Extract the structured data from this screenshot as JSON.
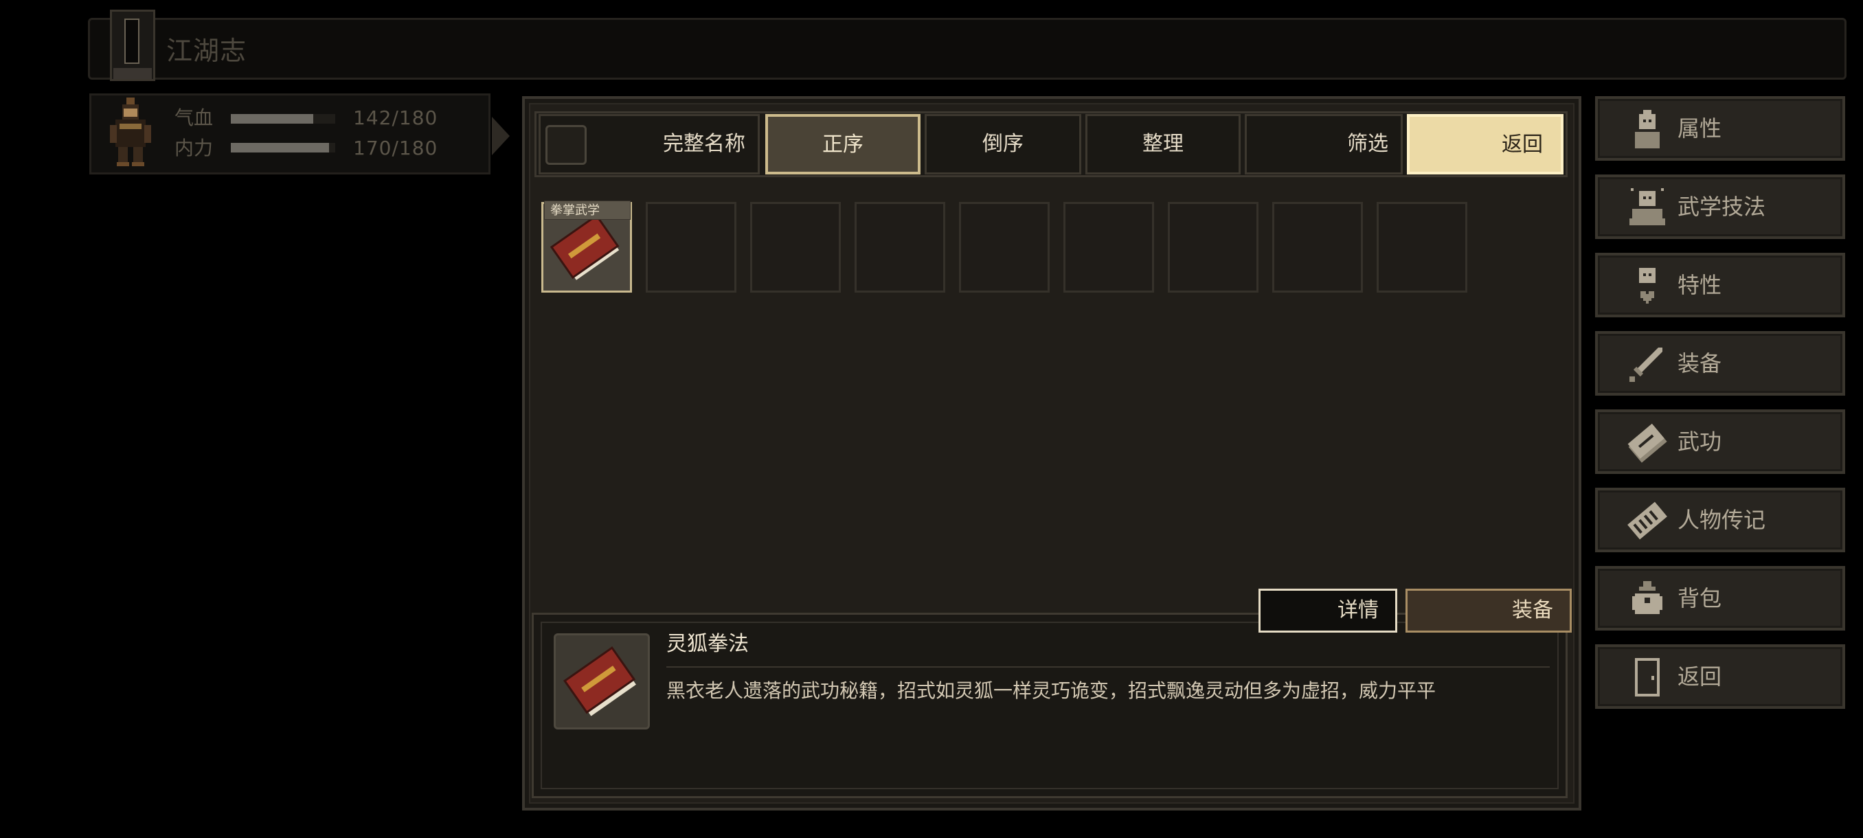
{
  "header": {
    "title": "江湖志"
  },
  "character": {
    "stats": [
      {
        "label": "气血",
        "value": "142/180",
        "fill": 0.789
      },
      {
        "label": "内力",
        "value": "170/180",
        "fill": 0.944
      }
    ]
  },
  "toolbar": {
    "full_name": "完整名称",
    "ascending": "正序",
    "descending": "倒序",
    "organize": "整理",
    "filter": "筛选",
    "back": "返回"
  },
  "inventory": {
    "items": [
      {
        "tag": "拳掌武学",
        "name": "灵狐拳法"
      }
    ],
    "empty_slots": 8
  },
  "actions": {
    "details": "详情",
    "equip": "装备"
  },
  "selected_item": {
    "name": "灵狐拳法",
    "description": "黑衣老人遗落的武功秘籍，招式如灵狐一样灵巧诡变，招式飘逸灵动但多为虚招，威力平平"
  },
  "side_menu": {
    "items": [
      {
        "label": "属性",
        "icon": "person-icon"
      },
      {
        "label": "武学技法",
        "icon": "meditate-icon"
      },
      {
        "label": "特性",
        "icon": "heart-person-icon"
      },
      {
        "label": "装备",
        "icon": "sword-icon"
      },
      {
        "label": "武功",
        "icon": "book-icon"
      },
      {
        "label": "人物传记",
        "icon": "scroll-icon"
      },
      {
        "label": "背包",
        "icon": "bag-icon"
      },
      {
        "label": "返回",
        "icon": "door-icon"
      }
    ]
  },
  "colors": {
    "panel_bg": "#211e19",
    "active_tab": "#4a4336",
    "return_button": "#ecdaa6",
    "item_book": "#8e2a22"
  }
}
